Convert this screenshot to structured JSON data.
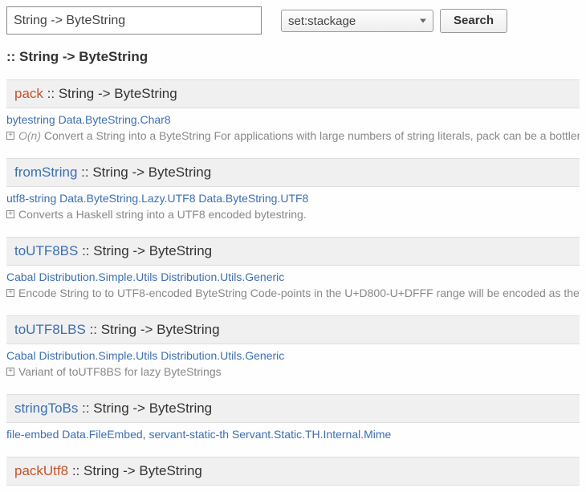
{
  "search": {
    "query_value": "String -> ByteString",
    "scope_selected": "set:stackage",
    "button_label": "Search"
  },
  "heading": ":: String -> ByteString",
  "results": [
    {
      "fn": "pack",
      "fn_color": "orange",
      "type": ":: String -> ByteString",
      "sources": [
        {
          "pkg": "bytestring",
          "mod": "Data.ByteString.Char8"
        }
      ],
      "desc_emph": "O(n)",
      "desc_text": " Convert a String into a ByteString For applications with large numbers of string literals, pack can be a bottleneck."
    },
    {
      "fn": "fromString",
      "fn_color": "blue",
      "type": ":: String -> ByteString",
      "sources": [
        {
          "pkg": "utf8-string",
          "mod": "Data.ByteString.Lazy.UTF8"
        },
        {
          "pkg": "",
          "mod": "Data.ByteString.UTF8"
        }
      ],
      "desc_emph": "",
      "desc_text": "Converts a Haskell string into a UTF8 encoded bytestring."
    },
    {
      "fn": "toUTF8BS",
      "fn_color": "blue",
      "type": ":: String -> ByteString",
      "sources": [
        {
          "pkg": "Cabal",
          "mod": "Distribution.Simple.Utils"
        },
        {
          "pkg": "",
          "mod": "Distribution.Utils.Generic"
        }
      ],
      "desc_emph": "",
      "desc_text": "Encode String to to UTF8-encoded ByteString Code-points in the U+D800-U+DFFF range will be encoded as the replacement c"
    },
    {
      "fn": "toUTF8LBS",
      "fn_color": "blue",
      "type": ":: String -> ByteString",
      "sources": [
        {
          "pkg": "Cabal",
          "mod": "Distribution.Simple.Utils"
        },
        {
          "pkg": "",
          "mod": "Distribution.Utils.Generic"
        }
      ],
      "desc_emph": "",
      "desc_text": "Variant of toUTF8BS for lazy ByteStrings"
    },
    {
      "fn": "stringToBs",
      "fn_color": "blue",
      "type": ":: String -> ByteString",
      "sources": [
        {
          "pkg": "file-embed",
          "mod": "Data.FileEmbed"
        },
        {
          "pkg": "servant-static-th",
          "mod": "Servant.Static.TH.Internal.Mime",
          "sep": ", "
        }
      ],
      "desc_emph": "",
      "desc_text": ""
    },
    {
      "fn": "packUtf8",
      "fn_color": "orange",
      "type": ":: String -> ByteString",
      "sources": [],
      "desc_emph": "",
      "desc_text": ""
    }
  ]
}
